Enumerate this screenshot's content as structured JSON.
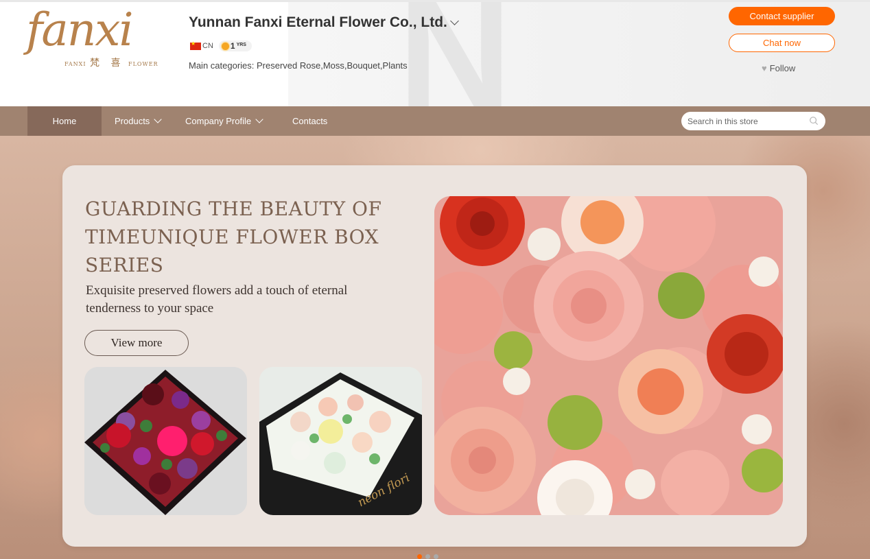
{
  "header": {
    "logo_text": "fanxi",
    "logo_sub_left": "FANXI",
    "logo_sub_cn": "梵 喜",
    "logo_sub_right": "FLOWER",
    "company_name": "Yunnan Fanxi Eternal Flower Co., Ltd.",
    "country": "CN",
    "years_num": "1",
    "years_label": "YRS",
    "categories": "Main categories: Preserved Rose,Moss,Bouquet,Plants",
    "contact_button": "Contact supplier",
    "chat_button": "Chat now",
    "follow_label": "Follow",
    "accent_color": "#ff6600"
  },
  "nav": {
    "items": [
      "Home",
      "Products",
      "Company Profile",
      "Contacts"
    ],
    "search_placeholder": "Search in this store",
    "bar_color": "#a08370"
  },
  "hero": {
    "title": "GUARDING THE BEAUTY OF TIMEUNIQUE FLOWER BOX SERIES",
    "subtitle": "Exquisite preserved flowers add a touch of eternal tenderness to your space",
    "button": "View more",
    "box_brand_text": "neon flori",
    "slide_count": 3,
    "active_slide": 1
  }
}
